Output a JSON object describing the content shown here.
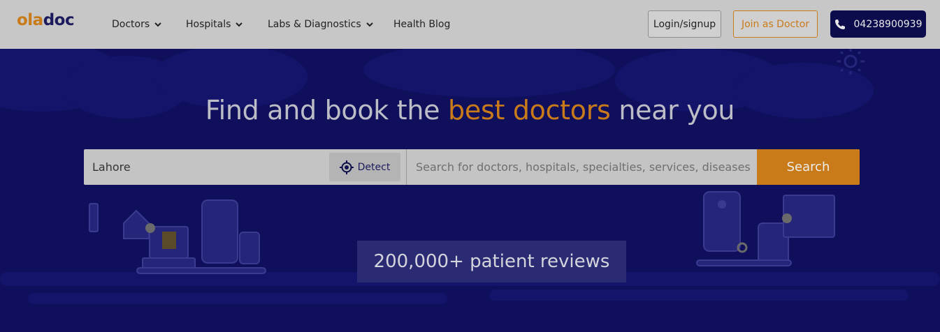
{
  "header": {
    "logo": {
      "part1": "ola",
      "part2": "doc"
    },
    "nav": [
      {
        "label": "Doctors",
        "has_dropdown": true
      },
      {
        "label": "Hospitals",
        "has_dropdown": true
      },
      {
        "label": "Labs & Diagnostics",
        "has_dropdown": true
      },
      {
        "label": "Health Blog",
        "has_dropdown": false
      }
    ],
    "login_label": "Login/signup",
    "join_label": "Join as Doctor",
    "phone": "04238900939",
    "phone_icon": "phone-icon"
  },
  "hero": {
    "headline_pre": "Find and book the",
    "headline_highlight": "best doctors",
    "headline_post": "near you",
    "search": {
      "location_value": "Lahore",
      "detect_label": "Detect",
      "detect_icon": "crosshair-icon",
      "query_placeholder": "Search for doctors, hospitals, specialties, services, diseases",
      "button_label": "Search"
    },
    "reviews_text": "200,000+ patient reviews"
  },
  "colors": {
    "header_bg": "#c7c7c7",
    "hero_bg": "#0f0f5c",
    "accent": "#c97a19",
    "brand_dark": "#1b1b5e"
  }
}
